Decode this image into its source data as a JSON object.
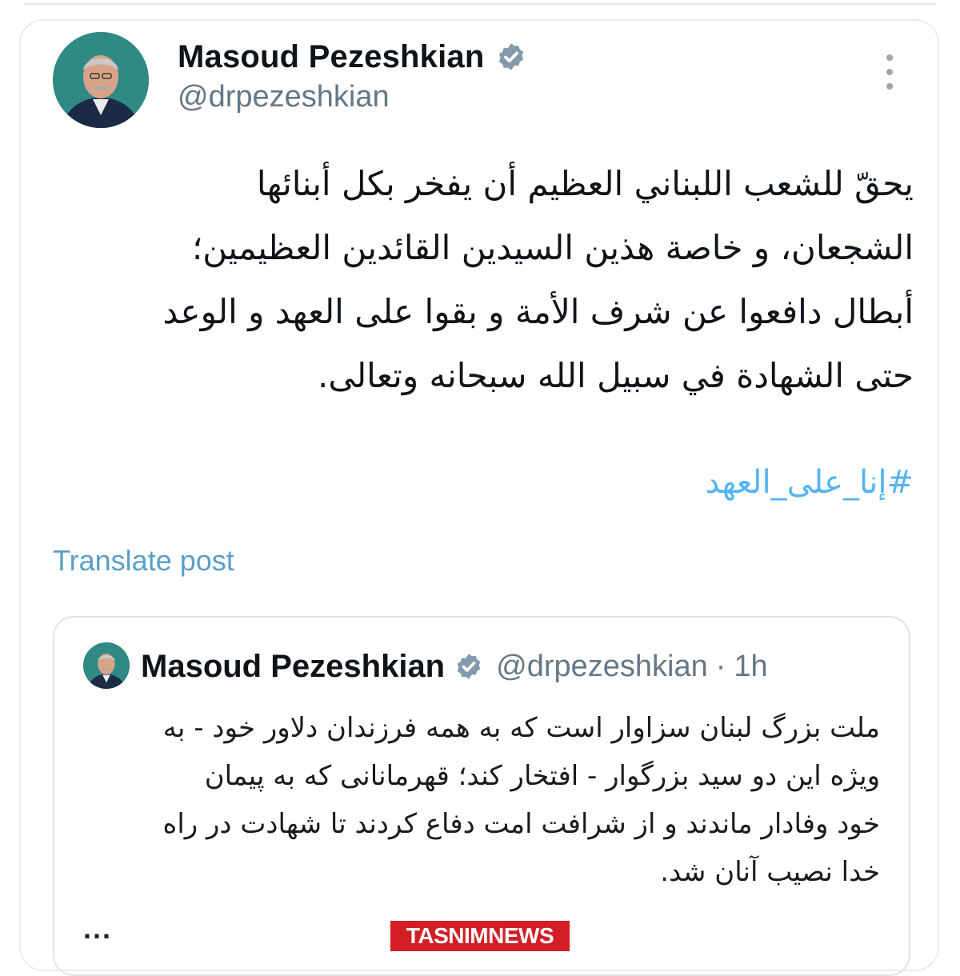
{
  "post": {
    "author_name": "Masoud Pezeshkian",
    "author_handle": "@drpezeshkian",
    "text_lines": [
      "يحقّ للشعب اللبناني العظيم أن يفخر بكل أبنائها",
      "الشجعان، و خاصة هذين السيدين القائدين العظيمين؛",
      "أبطال دافعوا عن شرف الأمة و بقوا على العهد و الوعد",
      "حتى الشهادة في سبيل الله سبحانه وتعالى."
    ],
    "hashtag": "#إنا_على_العهد",
    "translate_label": "Translate post",
    "more_icon": "more-vertical-icon",
    "verified_icon": "verified-badge-icon"
  },
  "quoted": {
    "author_name": "Masoud Pezeshkian",
    "author_handle": "@drpezeshkian",
    "separator": "·",
    "time": "1h",
    "text_lines": [
      "ملت بزرگ لبنان سزاوار است که به همه فرزندان دلاور خود - به",
      "ویژه این دو سید بزرگوار  - افتخار کند؛ قهرمانانی که به پیمان",
      "خود وفادار ماندند و از شرافت امت دفاع کردند تا شهادت در راه",
      "خدا نصیب آنان شد."
    ],
    "truncated_marker": "..."
  },
  "watermark": {
    "text": "TASNIMNEWS",
    "color": "#d21f26"
  },
  "colors": {
    "link": "#1d9bf0",
    "secondary_text": "#657786",
    "verified": "#829aab"
  }
}
